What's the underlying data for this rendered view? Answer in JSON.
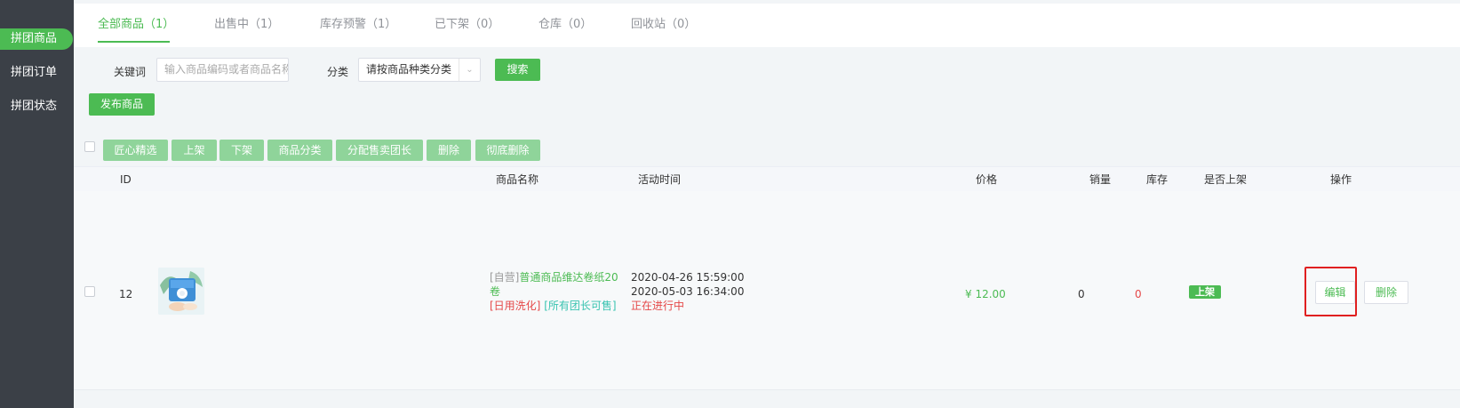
{
  "sidebar": {
    "items": [
      {
        "label": "拼团商品",
        "active": true
      },
      {
        "label": "拼团订单",
        "active": false
      },
      {
        "label": "拼团状态",
        "active": false
      }
    ]
  },
  "tabs": [
    {
      "label": "全部商品（1）",
      "active": true
    },
    {
      "label": "出售中（1）",
      "active": false
    },
    {
      "label": "库存预警（1）",
      "active": false
    },
    {
      "label": "已下架（0）",
      "active": false
    },
    {
      "label": "仓库（0）",
      "active": false
    },
    {
      "label": "回收站（0）",
      "active": false
    }
  ],
  "filter": {
    "keyword_label": "关键词",
    "keyword_placeholder": "输入商品编码或者商品名称",
    "category_label": "分类",
    "category_value": "请按商品种类分类",
    "search_button": "搜索"
  },
  "publish_button": "发布商品",
  "bulk_actions": [
    "匠心精选",
    "上架",
    "下架",
    "商品分类",
    "分配售卖团长",
    "删除",
    "彻底删除"
  ],
  "table": {
    "headers": {
      "id": "ID",
      "name": "商品名称",
      "time": "活动时间",
      "price": "价格",
      "sales": "销量",
      "stock": "库存",
      "on_shelf": "是否上架",
      "actions": "操作"
    },
    "rows": [
      {
        "id": "12",
        "name_prefix": "[自营]",
        "name": "普通商品维达卷纸20",
        "name_cont": "卷",
        "tag_category": "[日用洗化]",
        "tag_leader": "[所有团长可售]",
        "start_time": "2020-04-26 15:59:00",
        "end_time": "2020-05-03 16:34:00",
        "activity_status": "正在进行中",
        "price": "¥ 12.00",
        "sales": "0",
        "stock": "0",
        "on_shelf": "上架",
        "edit": "编辑",
        "delete": "删除"
      }
    ]
  },
  "colors": {
    "brand": "#4cbb53",
    "sidebar": "#3b4047",
    "danger": "#e54848",
    "highlight": "#e02020"
  }
}
